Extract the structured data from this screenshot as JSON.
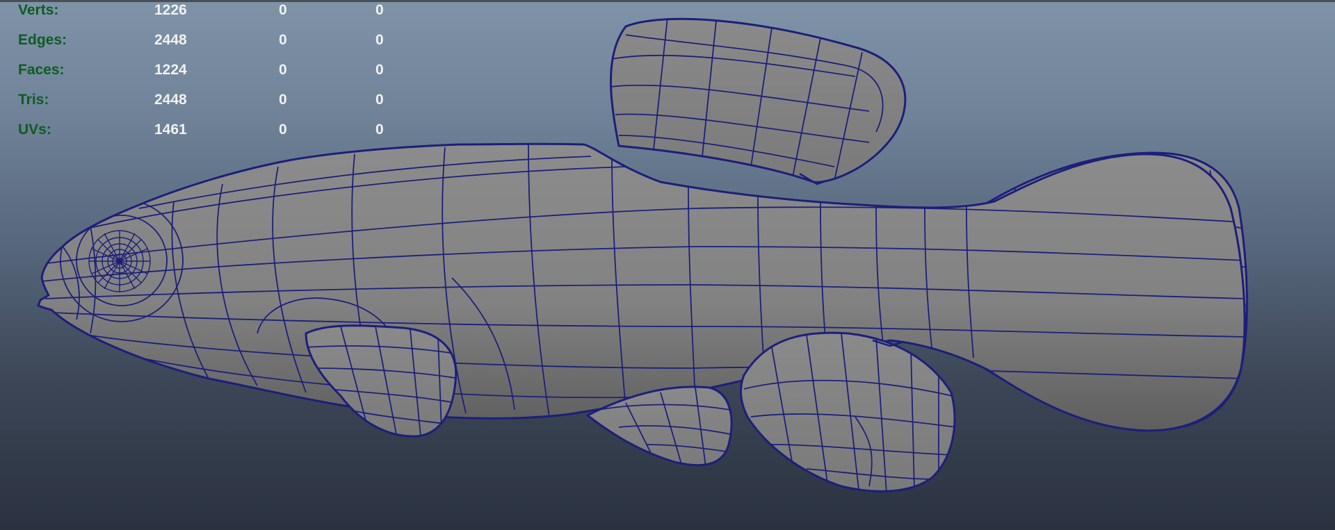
{
  "heads_up_display": {
    "rows": [
      {
        "label": "Verts:",
        "total": "1226",
        "selected": "0",
        "component": "0"
      },
      {
        "label": "Edges:",
        "total": "2448",
        "selected": "0",
        "component": "0"
      },
      {
        "label": "Faces:",
        "total": "1224",
        "selected": "0",
        "component": "0"
      },
      {
        "label": "Tris:",
        "total": "2448",
        "selected": "0",
        "component": "0"
      },
      {
        "label": "UVs:",
        "total": "1461",
        "selected": "0",
        "component": "0"
      }
    ]
  },
  "colors": {
    "label_green": "#0d5c22",
    "value_white": "#f2f2f2",
    "wireframe": "#1c1f7a",
    "mesh_fill": "#838383"
  },
  "viewport": {
    "object": "fish-mesh"
  }
}
